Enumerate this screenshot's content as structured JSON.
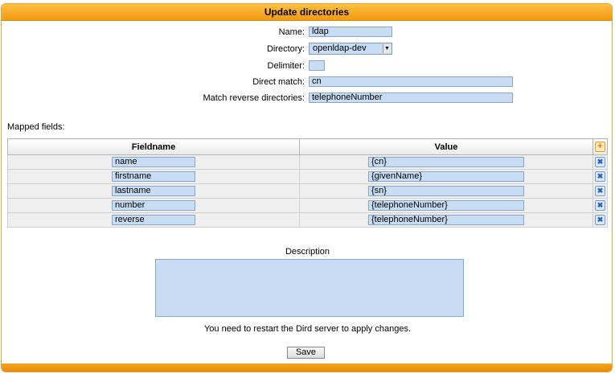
{
  "title": "Update directories",
  "form": {
    "name_label": "Name:",
    "name_value": "ldap",
    "directory_label": "Directory:",
    "directory_value": "openldap-dev",
    "delimiter_label": "Delimiter:",
    "delimiter_value": "",
    "direct_match_label": "Direct match:",
    "direct_match_value": "cn",
    "reverse_label": "Match reverse directories:",
    "reverse_value": "telephoneNumber"
  },
  "mapped": {
    "label": "Mapped fields:",
    "col_fieldname": "Fieldname",
    "col_value": "Value",
    "rows": [
      {
        "fieldname": "name",
        "value": "{cn}"
      },
      {
        "fieldname": "firstname",
        "value": "{givenName}"
      },
      {
        "fieldname": "lastname",
        "value": "{sn}"
      },
      {
        "fieldname": "number",
        "value": "{telephoneNumber}"
      },
      {
        "fieldname": "reverse",
        "value": "{telephoneNumber}"
      }
    ],
    "add_icon": "add-icon",
    "delete_icon": "delete-icon"
  },
  "description": {
    "label": "Description",
    "value": ""
  },
  "notice": "You need to restart the Dird server to apply changes.",
  "save_label": "Save",
  "colors": {
    "accent": "#f29a10",
    "field_bg": "#c8dcf4"
  }
}
